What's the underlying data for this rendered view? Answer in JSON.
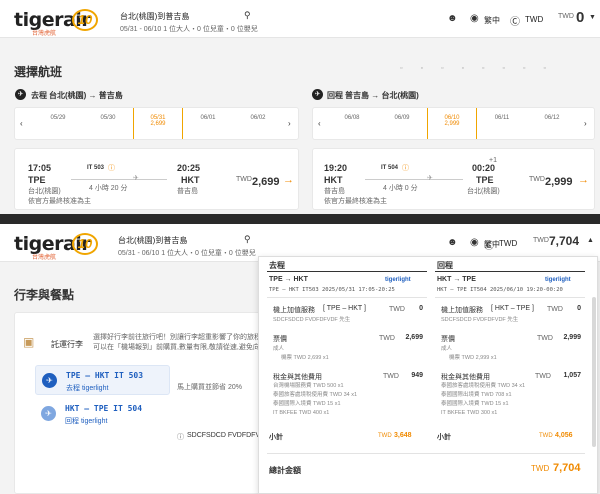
{
  "top": {
    "logo_text": "tigerair",
    "logo_sub": "台灣虎航",
    "anniv": "10",
    "route": "台北(桃園)到普吉島",
    "dates_pax": "05/31 - 06/10  1 位大人・0 位兒童・0 位嬰兒",
    "lang": "繁中",
    "currency": "TWD",
    "cart_currency": "TWD",
    "cart_total": "0"
  },
  "select": {
    "title": "選擇航班",
    "outbound": {
      "label": "去程",
      "route": "台北(桃園) → 普吉島",
      "dates": [
        {
          "d": "05/29",
          "p": ""
        },
        {
          "d": "05/30",
          "p": ""
        },
        {
          "d": "05/31",
          "p": "2,699"
        },
        {
          "d": "06/01",
          "p": ""
        },
        {
          "d": "06/02",
          "p": ""
        }
      ],
      "dep_time": "17:05",
      "flight": "IT 503",
      "arr_time": "20:25",
      "dep_code": "TPE",
      "arr_code": "HKT",
      "dep_city": "台北(桃園)",
      "arr_city": "普吉島",
      "duration": "4 小時 20 分",
      "note": "依官方最終核准為主",
      "cur": "TWD",
      "price": "2,699"
    },
    "inbound": {
      "label": "回程",
      "route": "普吉島 → 台北(桃園)",
      "dates": [
        {
          "d": "06/08",
          "p": ""
        },
        {
          "d": "06/09",
          "p": ""
        },
        {
          "d": "06/10",
          "p": "2,999"
        },
        {
          "d": "06/11",
          "p": ""
        },
        {
          "d": "06/12",
          "p": ""
        }
      ],
      "dep_time": "19:20",
      "flight": "IT 504",
      "arr_time": "00:20",
      "plus_day": "+1",
      "dep_code": "HKT",
      "arr_code": "TPE",
      "dep_city": "普吉島",
      "arr_city": "台北(桃園)",
      "duration": "4 小時 0 分",
      "note": "依官方最終核准為主",
      "cur": "TWD",
      "price": "2,999"
    }
  },
  "top2": {
    "route": "台北(桃園)到普吉島",
    "dates_pax": "05/31 - 06/10  1 位大人・0 位兒童・0 位嬰兒",
    "lang": "繁中",
    "currency": "TWD",
    "cart_currency": "TWD",
    "cart_total": "7,704"
  },
  "addons": {
    "title": "行李與餐點",
    "baggage_label": "託運行李",
    "baggage_desc": "選擇好行李前往旅行吧！別讓行李超重影響了你的旅程。另外,您也可以在「機場報到」前購買,數量有限,敬請從速,避免向隅。",
    "legs": [
      {
        "code": "TPE – HKT IT 503",
        "sub": "去程 tigerlight"
      },
      {
        "code": "HKT – TPE IT 504",
        "sub": "回程 tigerlight"
      }
    ],
    "promo": "馬上購買並節省 20%",
    "pax": "SDCFSDCD FVDFDFV"
  },
  "summary": {
    "out": {
      "head": "去程",
      "route": "TPE → HKT",
      "brand": "tigerlight",
      "detail": "TPE – HKT  IT503  2025/05/31  17:05-20:25",
      "svc_label": "機上加值服務",
      "svc_route": "[ TPE – HKT ]",
      "svc_cur": "TWD",
      "svc_val": "0",
      "svc_pax": "SDCFSDCD FVDFDFVDF 先生",
      "fare_label": "票價",
      "fare_cur": "TWD",
      "fare_val": "2,699",
      "fare_sub1": "成人",
      "fare_sub2": "機票 TWD 2,699 x1",
      "tax_label": "稅金與其他費用",
      "tax_cur": "TWD",
      "tax_val": "949",
      "tax_items": [
        "台灣機場服務費 TWD 500 x1",
        "泰國旅客處境稅使用費 TWD 34 x1",
        "泰國國際入境費 TWD 15 x1",
        "IT BKFEE TWD 400 x1"
      ],
      "sub_label": "小計",
      "sub_cur": "TWD",
      "sub_val": "3,648"
    },
    "ret": {
      "head": "回程",
      "route": "HKT → TPE",
      "brand": "tigerlight",
      "detail": "HKT – TPE  IT504  2025/06/10  19:20-00:20",
      "svc_label": "機上加值服務",
      "svc_route": "[ HKT – TPE ]",
      "svc_cur": "TWD",
      "svc_val": "0",
      "svc_pax": "SDCFSDCD FVDFDFVDF 先生",
      "fare_label": "票價",
      "fare_cur": "TWD",
      "fare_val": "2,999",
      "fare_sub1": "成人",
      "fare_sub2": "機票 TWD 2,999 x1",
      "tax_label": "稅金與其他費用",
      "tax_cur": "TWD",
      "tax_val": "1,057",
      "tax_items": [
        "泰國旅客處境稅使用費 TWD 34 x1",
        "泰國國際出境費 TWD 708 x1",
        "泰國國際入境費 TWD 15 x1",
        "IT BKFEE TWD 300 x1"
      ],
      "sub_label": "小計",
      "sub_cur": "TWD",
      "sub_val": "4,056"
    },
    "total_label": "總計金額",
    "total_cur": "TWD",
    "total_val": "7,704"
  }
}
